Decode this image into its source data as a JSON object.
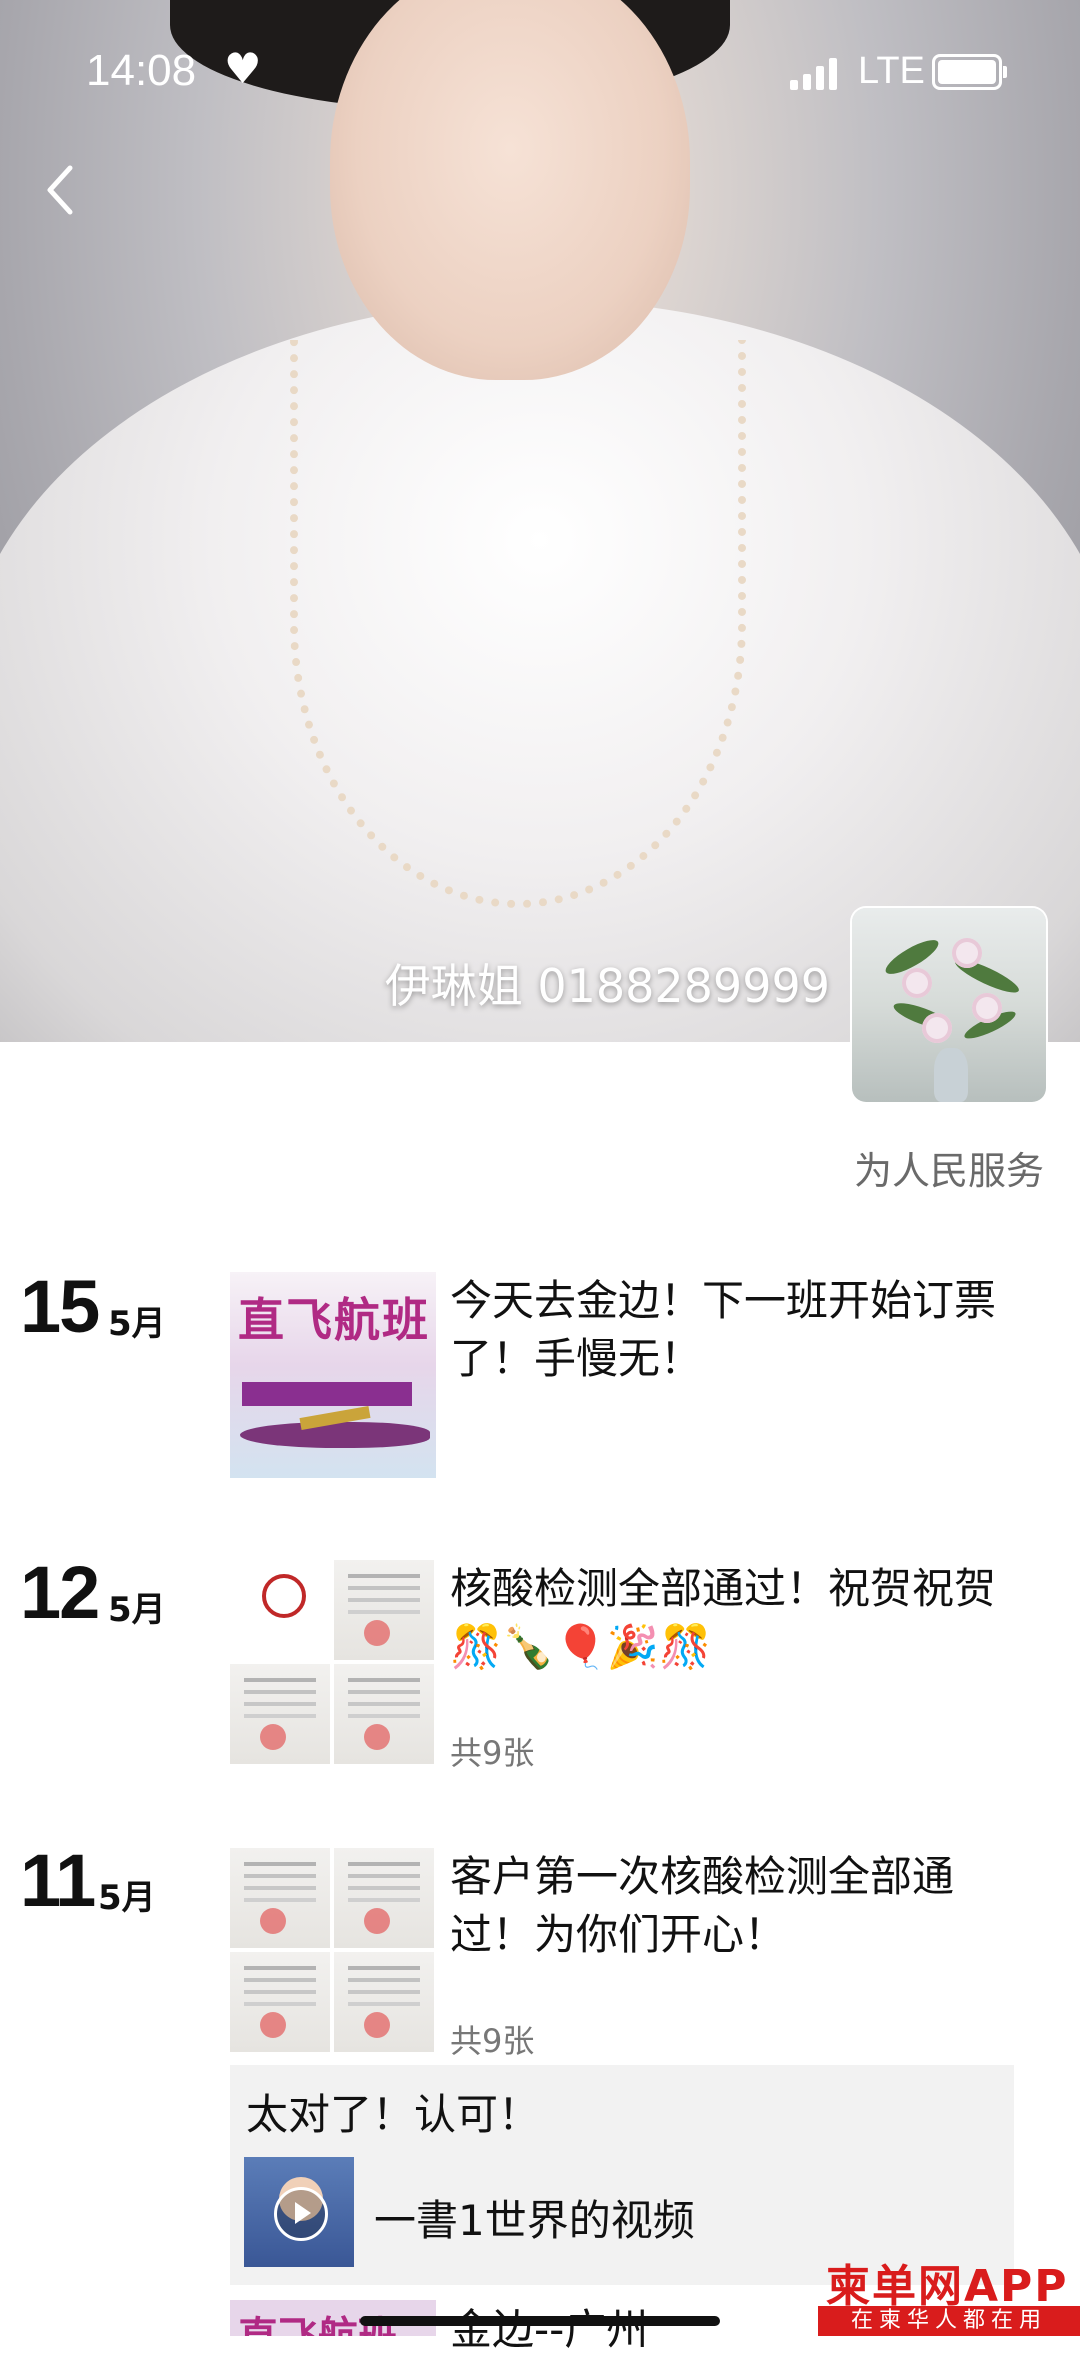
{
  "status_bar": {
    "time": "14:08",
    "network": "LTE"
  },
  "profile": {
    "nickname": "伊琳姐 0188289999",
    "signature": "为人民服务"
  },
  "posts": [
    {
      "day": "15",
      "month": "5月",
      "text": "今天去金边！下一班开始订票了！手慢无！",
      "thumb_text": "直飞航班"
    },
    {
      "day": "12",
      "month": "5月",
      "text": "核酸检测全部通过！祝贺祝贺🎊🍾🎈🎉🎊",
      "count": "共9张"
    },
    {
      "day": "11",
      "month": "5月",
      "text": "客户第一次核酸检测全部通过！为你们开心！",
      "count": "共9张",
      "comment": "太对了！认可！",
      "shared_title": "一書1世界的视频"
    }
  ],
  "next_post": {
    "thumb_text": "直飞航班",
    "text": "金边--广州"
  },
  "watermark": {
    "main": "柬单网APP",
    "sub": "在柬华人都在用"
  }
}
